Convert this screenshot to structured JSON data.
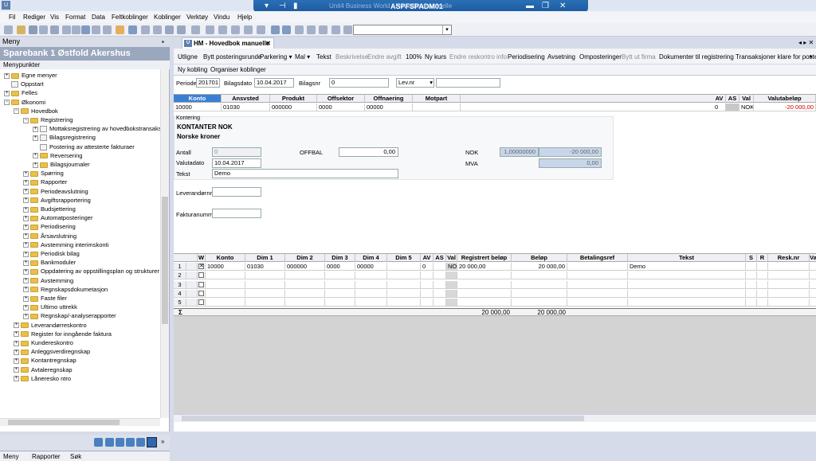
{
  "window": {
    "title": "ASPFSPADM01",
    "ghost_title": "Unit4 Business World - Hovedbok manuelle"
  },
  "menubar": [
    "Fil",
    "Rediger",
    "Vis",
    "Format",
    "Data",
    "Feltkoblinger",
    "Koblinger",
    "Verktøy",
    "Vindu",
    "Hjelp"
  ],
  "left_panel": {
    "header": "Meny",
    "bank_name": "Sparebank 1 Østfold Akershus",
    "subtitle": "Menypunkter",
    "tree": [
      {
        "label": "Egne menyer",
        "level": 0,
        "exp": "+",
        "icon": "folder"
      },
      {
        "label": "Oppstart",
        "level": 0,
        "exp": "",
        "icon": "doc"
      },
      {
        "label": "Felles",
        "level": 0,
        "exp": "+",
        "icon": "folder"
      },
      {
        "label": "Økonomi",
        "level": 0,
        "exp": "-",
        "icon": "folder"
      },
      {
        "label": "Hovedbok",
        "level": 1,
        "exp": "-",
        "icon": "folder"
      },
      {
        "label": "Registrering",
        "level": 2,
        "exp": "-",
        "icon": "folder"
      },
      {
        "label": "Mottaksregistrering av hovedbokstransaksjoner",
        "level": 3,
        "exp": "+",
        "icon": "doc"
      },
      {
        "label": "Bilagsregistrering",
        "level": 3,
        "exp": "+",
        "icon": "doc"
      },
      {
        "label": "Postering av attesterte fakturaer",
        "level": 3,
        "exp": "",
        "icon": "doc"
      },
      {
        "label": "Reversering",
        "level": 3,
        "exp": "+",
        "icon": "folder"
      },
      {
        "label": "Bilagsjournaler",
        "level": 3,
        "exp": "+",
        "icon": "folder"
      },
      {
        "label": "Spørring",
        "level": 2,
        "exp": "+",
        "icon": "folder"
      },
      {
        "label": "Rapporter",
        "level": 2,
        "exp": "+",
        "icon": "folder"
      },
      {
        "label": "Periodeavslutning",
        "level": 2,
        "exp": "+",
        "icon": "folder"
      },
      {
        "label": "Avgiftsrapportering",
        "level": 2,
        "exp": "+",
        "icon": "folder"
      },
      {
        "label": "Budsjettering",
        "level": 2,
        "exp": "+",
        "icon": "folder"
      },
      {
        "label": "Automatposteringer",
        "level": 2,
        "exp": "+",
        "icon": "folder"
      },
      {
        "label": "Periodisering",
        "level": 2,
        "exp": "+",
        "icon": "folder"
      },
      {
        "label": "Årsavslutning",
        "level": 2,
        "exp": "+",
        "icon": "folder"
      },
      {
        "label": "Avstemming interimskonti",
        "level": 2,
        "exp": "+",
        "icon": "folder"
      },
      {
        "label": "Periodisk bilag",
        "level": 2,
        "exp": "+",
        "icon": "folder"
      },
      {
        "label": "Bankmoduler",
        "level": 2,
        "exp": "+",
        "icon": "folder"
      },
      {
        "label": "Oppdatering av oppstillingsplan og strukturer",
        "level": 2,
        "exp": "+",
        "icon": "folder"
      },
      {
        "label": "Avstemming",
        "level": 2,
        "exp": "+",
        "icon": "folder"
      },
      {
        "label": "Regnskapsdokumetasjon",
        "level": 2,
        "exp": "+",
        "icon": "folder"
      },
      {
        "label": "Faste filer",
        "level": 2,
        "exp": "+",
        "icon": "folder"
      },
      {
        "label": "Ultimo uttrekk",
        "level": 2,
        "exp": "+",
        "icon": "folder"
      },
      {
        "label": "Regnskap/-analyserapporter",
        "level": 2,
        "exp": "+",
        "icon": "folder"
      },
      {
        "label": "Leverandørreskontro",
        "level": 1,
        "exp": "+",
        "icon": "folder"
      },
      {
        "label": "Register for inngående faktura",
        "level": 1,
        "exp": "+",
        "icon": "folder"
      },
      {
        "label": "Kundereskontro",
        "level": 1,
        "exp": "+",
        "icon": "folder"
      },
      {
        "label": "Anleggsverdiregnskap",
        "level": 1,
        "exp": "+",
        "icon": "folder"
      },
      {
        "label": "Kontantregnskap",
        "level": 1,
        "exp": "+",
        "icon": "folder"
      },
      {
        "label": "Avtaleregnskap",
        "level": 1,
        "exp": "+",
        "icon": "folder"
      },
      {
        "label": "Låneresko ntro",
        "level": 1,
        "exp": "+",
        "icon": "folder"
      }
    ],
    "tabs": [
      "Meny",
      "Rapporter",
      "Søk"
    ]
  },
  "doc_tab": {
    "label": "HM - Hovedbok manuelle"
  },
  "task_row1": [
    {
      "label": "Utligne",
      "enabled": true
    },
    {
      "label": "Bytt posteringsrunde",
      "enabled": true
    },
    {
      "label": "Parkering ▾",
      "enabled": true
    },
    {
      "label": "Mal ▾",
      "enabled": true
    },
    {
      "label": "Tekst",
      "enabled": true
    },
    {
      "label": "Beskrivelse",
      "enabled": false
    },
    {
      "label": "Endre avgift",
      "enabled": false
    },
    {
      "label": "100%",
      "enabled": true
    },
    {
      "label": "Ny kurs",
      "enabled": true
    },
    {
      "label": "Endre reskontro info",
      "enabled": false
    },
    {
      "label": "Periodisering",
      "enabled": true
    },
    {
      "label": "Avsetning",
      "enabled": true
    },
    {
      "label": "Omposteringer",
      "enabled": true
    },
    {
      "label": "Bytt ut firma",
      "enabled": false
    },
    {
      "label": "Dokumenter til registrering",
      "enabled": true
    },
    {
      "label": "Transaksjoner klare for postering",
      "enabled": true
    }
  ],
  "task_row2": [
    "Ny kobling",
    "Organiser koblinger"
  ],
  "header_fields": {
    "periode_label": "Periode",
    "periode": "201701",
    "bilagsdato_label": "Bilagsdato",
    "bilagsdato": "10.04.2017",
    "bilagsnr_label": "Bilagsnr",
    "bilagsnr": "0",
    "levnr_option": "Lev.nr"
  },
  "account_grid": {
    "headers": [
      "Konto",
      "Ansvsted",
      "Produkt",
      "Offsektor",
      "Offnaering",
      "Motpart",
      "AV",
      "AS",
      "Val",
      "Valutabeløp"
    ],
    "row": [
      "10000",
      "01030",
      "000000",
      "0000",
      "00000",
      "",
      "0",
      "",
      "NOK",
      "-20 000,00"
    ]
  },
  "kontering": {
    "section_label": "Kontering",
    "account_name": "KONTANTER NOK",
    "currency_name": "Norske kroner",
    "antall_label": "Antall",
    "antall": "0",
    "offbal_label": "OFFBAL",
    "offbal": "0,00",
    "nok_label": "NOK",
    "nok_rate": "1,00000000",
    "nok_amount": "-20 000,00",
    "valutadato_label": "Valutadato",
    "valutadato": "10.04.2017",
    "mva_label": "MVA",
    "mva": "0,00",
    "tekst_label": "Tekst",
    "tekst": "Demo",
    "leverandor_label": "Leverandørnr",
    "faktura_label": "Fakturanummer"
  },
  "lines_grid": {
    "headers": [
      "W",
      "Konto",
      "Dim 1",
      "Dim 2",
      "Dim 3",
      "Dim 4",
      "Dim 5",
      "AV",
      "AS",
      "Val",
      "Registrert beløp",
      "Beløp",
      "Betalingsref",
      "Tekst",
      "S",
      "R",
      "Resk.nr",
      "Va"
    ],
    "rows": [
      {
        "nr": "1",
        "checked": true,
        "cells": [
          "10000",
          "01030",
          "000000",
          "0000",
          "00000",
          "",
          "0",
          "",
          "NOK",
          "20 000,00",
          "20 000,00",
          "",
          "Demo",
          "",
          "",
          "",
          ""
        ]
      },
      {
        "nr": "2",
        "checked": false,
        "cells": [
          "",
          "",
          "",
          "",
          "",
          "",
          "",
          "",
          "",
          "",
          "",
          "",
          "",
          "",
          "",
          "",
          ""
        ]
      },
      {
        "nr": "3",
        "checked": false,
        "cells": [
          "",
          "",
          "",
          "",
          "",
          "",
          "",
          "",
          "",
          "",
          "",
          "",
          "",
          "",
          "",
          "",
          ""
        ]
      },
      {
        "nr": "4",
        "checked": false,
        "cells": [
          "",
          "",
          "",
          "",
          "",
          "",
          "",
          "",
          "",
          "",
          "",
          "",
          "",
          "",
          "",
          "",
          ""
        ]
      },
      {
        "nr": "5",
        "checked": false,
        "cells": [
          "",
          "",
          "",
          "",
          "",
          "",
          "",
          "",
          "",
          "",
          "",
          "",
          "",
          "",
          "",
          "",
          ""
        ]
      }
    ],
    "sum_symbol": "Σ",
    "sum_registrert": "20 000,00",
    "sum_belop": "20 000,00"
  }
}
